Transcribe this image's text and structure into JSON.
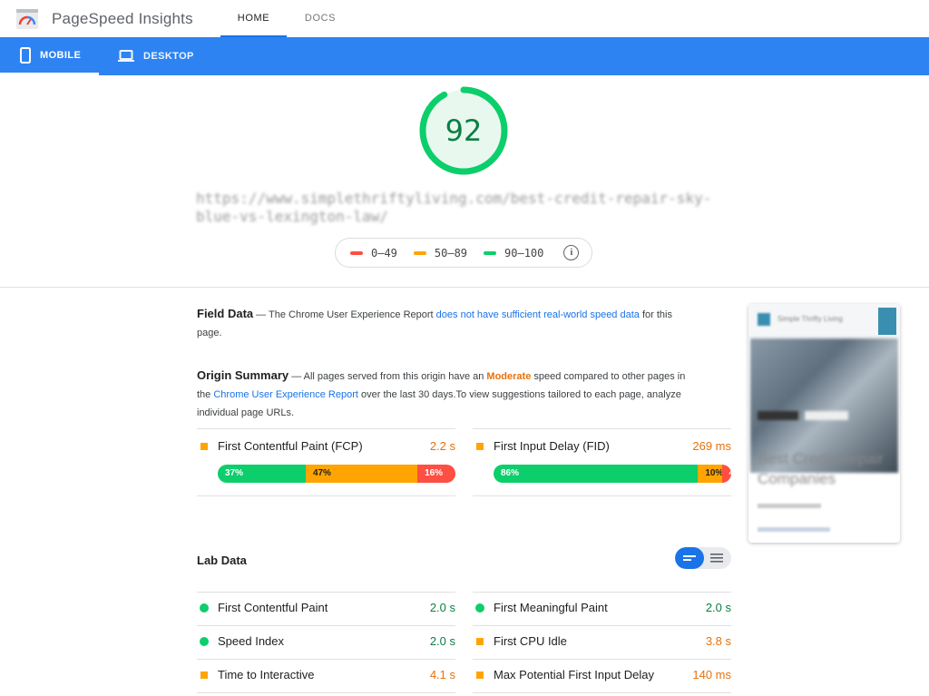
{
  "app": {
    "title": "PageSpeed Insights"
  },
  "nav": {
    "tabs": [
      "HOME",
      "DOCS"
    ]
  },
  "device_tabs": {
    "mobile": "MOBILE",
    "desktop": "DESKTOP"
  },
  "score": {
    "value": "92",
    "fraction": 0.92,
    "color": "#0cce6b"
  },
  "url": "https://www.simplethriftyliving.com/best-credit-repair-sky-blue-vs-lexington-law/",
  "legend": {
    "items": [
      {
        "label": "0–49",
        "color": "#ff4e42"
      },
      {
        "label": "50–89",
        "color": "#ffa400"
      },
      {
        "label": "90–100",
        "color": "#0cce6b"
      }
    ],
    "info_icon": "i"
  },
  "field_data": {
    "heading": "Field Data",
    "text_before": " — The Chrome User Experience Report ",
    "link": "does not have sufficient real-world speed data",
    "text_after": " for this page."
  },
  "origin_summary": {
    "heading": "Origin Summary",
    "text1": " — All pages served from this origin have an ",
    "moderate": "Moderate",
    "text2": " speed compared to other pages in the ",
    "link": "Chrome User Experience Report",
    "text3": " over the last 30 days.To view suggestions tailored to each page, analyze individual page URLs."
  },
  "field_metrics": [
    {
      "label": "First Contentful Paint (FCP)",
      "value": "2.2 s",
      "status_color": "#ffa400",
      "value_color": "#e8710a",
      "distribution": [
        {
          "pct": "37%",
          "frac": 0.37
        },
        {
          "pct": "47%",
          "frac": 0.47
        },
        {
          "pct": "16%",
          "frac": 0.16
        }
      ]
    },
    {
      "label": "First Input Delay (FID)",
      "value": "269 ms",
      "status_color": "#ffa400",
      "value_color": "#e8710a",
      "distribution": [
        {
          "pct": "86%",
          "frac": 0.86
        },
        {
          "pct": "10%",
          "frac": 0.1
        },
        {
          "pct": "4%",
          "frac": 0.04
        }
      ]
    }
  ],
  "lab_data": {
    "heading": "Lab Data",
    "metrics": [
      {
        "label": "First Contentful Paint",
        "value": "2.0 s",
        "status": "good"
      },
      {
        "label": "First Meaningful Paint",
        "value": "2.0 s",
        "status": "good"
      },
      {
        "label": "Speed Index",
        "value": "2.0 s",
        "status": "good"
      },
      {
        "label": "First CPU Idle",
        "value": "3.8 s",
        "status": "average"
      },
      {
        "label": "Time to Interactive",
        "value": "4.1 s",
        "status": "average"
      },
      {
        "label": "Max Potential First Input Delay",
        "value": "140 ms",
        "status": "average"
      }
    ]
  },
  "thumbnail": {
    "site_name": "Simple Thrifty Living",
    "headline": "Best Credit Repair Companies"
  },
  "colors": {
    "accent_blue": "#2e83f2",
    "good": "#0cce6b",
    "average": "#ffa400",
    "poor": "#ff4e42",
    "good_text": "#0b8043",
    "average_text": "#e8710a"
  }
}
